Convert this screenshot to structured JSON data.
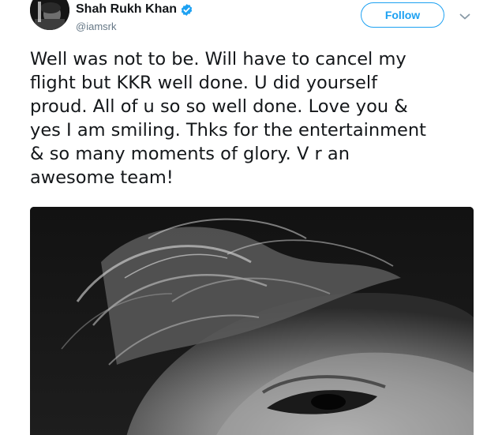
{
  "tweet": {
    "author": {
      "display_name": "Shah Rukh Khan",
      "handle": "@iamsrk",
      "verified": true,
      "avatar_icon": "profile-photo"
    },
    "follow_label": "Follow",
    "more_icon": "chevron-down-icon",
    "text_lines": [
      "Well was not to be. Will have to cancel my",
      "flight but KKR well done. U did yourself",
      "proud. All of u so so well done. Love you &",
      "yes I am smiling. Thks for the entertainment",
      "& so many moments of glory. V r an",
      "awesome team!"
    ],
    "media": {
      "kind": "black-and-white photo",
      "icon": "photo"
    }
  },
  "colors": {
    "accent": "#1da1f2",
    "text": "#14171a",
    "secondary_text": "#657786",
    "verified_badge": "#1da1f2"
  }
}
